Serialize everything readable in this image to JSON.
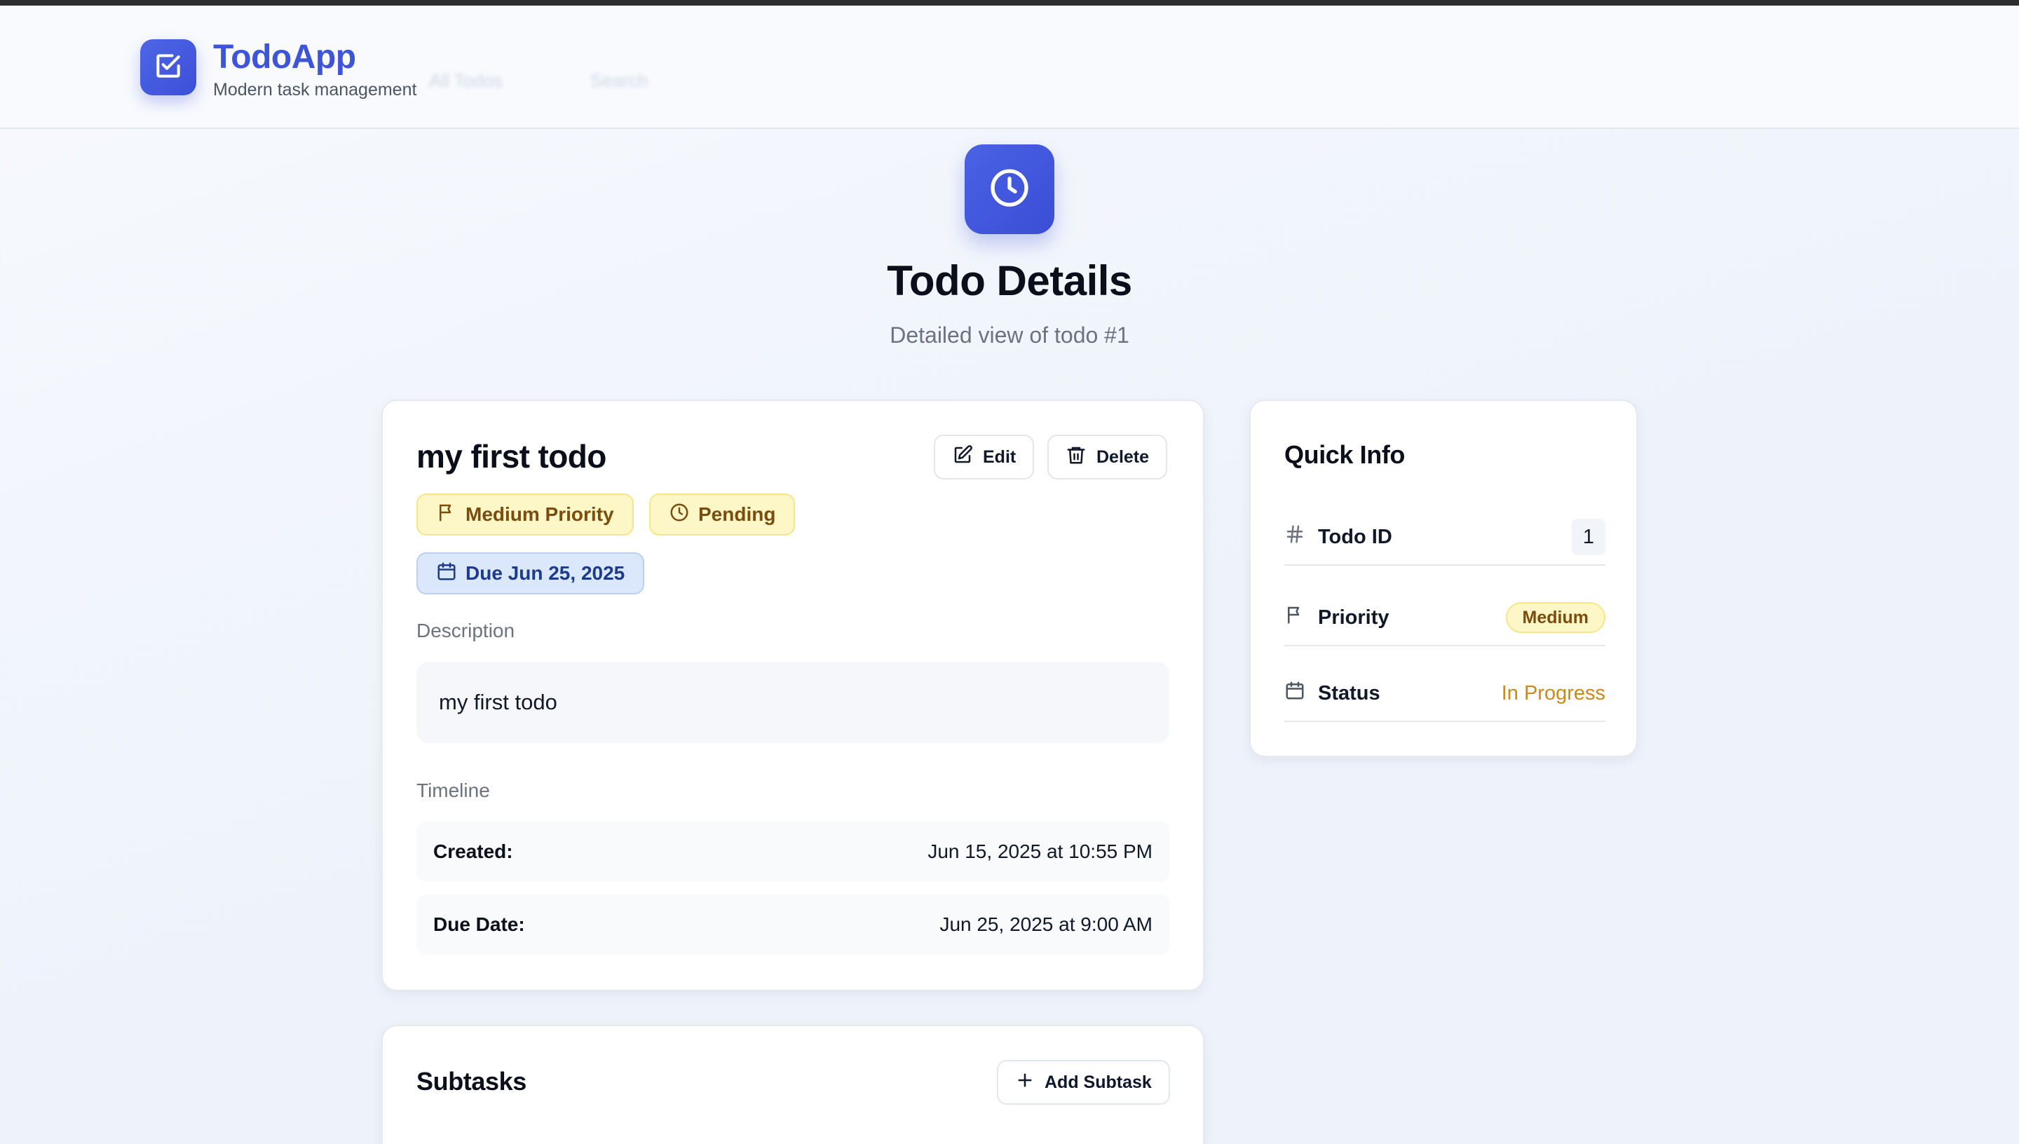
{
  "header": {
    "brand_title": "TodoApp",
    "brand_subtitle": "Modern task management",
    "nav_items": [
      "All Todos",
      "Search"
    ],
    "logo_icon": "checkbox-icon"
  },
  "hero": {
    "icon": "clock-icon",
    "title": "Todo Details",
    "subtitle": "Detailed view of todo #1"
  },
  "todo": {
    "title": "my first todo",
    "edit_label": "Edit",
    "delete_label": "Delete",
    "priority_badge": "Medium Priority",
    "status_badge": "Pending",
    "due_badge": "Due Jun 25, 2025",
    "description_label": "Description",
    "description": "my first todo",
    "timeline_label": "Timeline",
    "timeline": [
      {
        "label": "Created:",
        "value": "Jun 15, 2025 at 10:55 PM"
      },
      {
        "label": "Due Date:",
        "value": "Jun 25, 2025 at 9:00 AM"
      }
    ]
  },
  "quick_info": {
    "title": "Quick Info",
    "id_label": "Todo ID",
    "id_value": "1",
    "priority_label": "Priority",
    "priority_value": "Medium",
    "status_label": "Status",
    "status_value": "In Progress"
  },
  "subtasks": {
    "title": "Subtasks",
    "add_label": "Add Subtask"
  },
  "colors": {
    "accent": "#3d55d6",
    "badge_yellow_bg": "#fdf6c7",
    "badge_blue_bg": "#dbe8fb",
    "status_in_progress": "#c98a1a"
  }
}
